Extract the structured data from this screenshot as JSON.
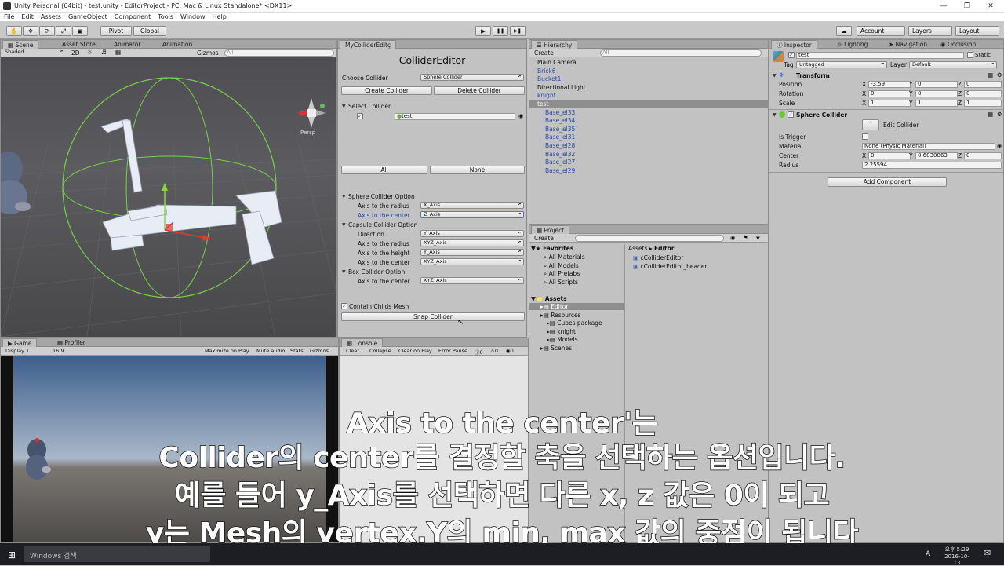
{
  "window": {
    "title": "Unity Personal (64bit) - test.unity - EditorProject - PC, Mac & Linux Standalone* <DX11>",
    "controls": [
      "—",
      "❐",
      "✕"
    ]
  },
  "menu": [
    "File",
    "Edit",
    "Assets",
    "GameObject",
    "Component",
    "Tools",
    "Window",
    "Help"
  ],
  "toolbar": {
    "pivot": "Pivot",
    "global": "Global",
    "play": "▶",
    "pause": "❚❚",
    "step": "▶❚",
    "account": "Account",
    "layers": "Layers",
    "layout": "Layout"
  },
  "scene": {
    "tabs": [
      "Scene",
      "Asset Store",
      "Animator",
      "Animation"
    ],
    "shading": "Shaded",
    "mode_2d": "2D",
    "gizmos": "Gizmos",
    "search_placeholder": "All",
    "persp": "Persp"
  },
  "collider_editor": {
    "tab": "MyColliderEditç",
    "title": "ColliderEditor",
    "choose_label": "Choose Collider",
    "choose_value": "Sphere Collider",
    "create_button": "Create Collider",
    "delete_button": "Delete Collider",
    "select_header": "Select Collider",
    "selected_item": "test",
    "all_button": "All",
    "none_button": "None",
    "sphere_header": "Sphere Collider Option",
    "sphere_radius_label": "Axis to the radius",
    "sphere_radius_value": "X_Axis",
    "sphere_center_label": "Axis to the center",
    "sphere_center_value": "Z_Axis",
    "capsule_header": "Capsule Collider Option",
    "capsule_direction_label": "Direction",
    "capsule_direction_value": "Y_Axis",
    "capsule_radius_label": "Axis to the radius",
    "capsule_radius_value": "XYZ_Axis",
    "capsule_height_label": "Axis to the height",
    "capsule_height_value": "Y_Axis",
    "capsule_center_label": "Axis to the center",
    "capsule_center_value": "XYZ_Axis",
    "box_header": "Box Collider Option",
    "box_center_label": "Axis to the center",
    "box_center_value": "XYZ_Axis",
    "contain_label": "Contain Childs Mesh",
    "snap_button": "Snap Collider"
  },
  "hierarchy": {
    "tab": "Hierarchy",
    "create": "Create",
    "search_placeholder": "All",
    "items": [
      {
        "label": "Main Camera",
        "indent": 0,
        "style": "normal"
      },
      {
        "label": "Brick6",
        "indent": 0,
        "style": "blue"
      },
      {
        "label": "Bucket1",
        "indent": 0,
        "style": "blue"
      },
      {
        "label": "Directional Light",
        "indent": 0,
        "style": "normal"
      },
      {
        "label": "knight",
        "indent": 0,
        "style": "blue"
      },
      {
        "label": "test",
        "indent": 0,
        "style": "selected"
      },
      {
        "label": "Base_el33",
        "indent": 1,
        "style": "blue"
      },
      {
        "label": "Base_el34",
        "indent": 1,
        "style": "blue"
      },
      {
        "label": "Base_el35",
        "indent": 1,
        "style": "blue"
      },
      {
        "label": "Base_el31",
        "indent": 1,
        "style": "blue"
      },
      {
        "label": "Base_el28",
        "indent": 1,
        "style": "blue"
      },
      {
        "label": "Base_el32",
        "indent": 1,
        "style": "blue"
      },
      {
        "label": "Base_el27",
        "indent": 1,
        "style": "blue"
      },
      {
        "label": "Base_el29",
        "indent": 1,
        "style": "blue"
      }
    ]
  },
  "project": {
    "tab": "Project",
    "create": "Create",
    "favorites_header": "Favorites",
    "favorites": [
      "All Materials",
      "All Models",
      "All Prefabs",
      "All Scripts"
    ],
    "assets_header": "Assets",
    "tree": [
      {
        "label": "Editor",
        "indent": 1,
        "selected": true
      },
      {
        "label": "Resources",
        "indent": 1,
        "selected": false
      },
      {
        "label": "Cubes package",
        "indent": 2,
        "selected": false
      },
      {
        "label": "knight",
        "indent": 2,
        "selected": false
      },
      {
        "label": "Models",
        "indent": 2,
        "selected": false
      },
      {
        "label": "Scenes",
        "indent": 1,
        "selected": false
      }
    ],
    "breadcrumb_root": "Assets",
    "breadcrumb_sep": "▸",
    "breadcrumb_current": "Editor",
    "files": [
      "cColliderEditor",
      "cColliderEditor_header"
    ]
  },
  "inspector": {
    "tabs": [
      "Inspector",
      "Lighting",
      "Navigation",
      "Occlusion"
    ],
    "object_name": "test",
    "static_label": "Static",
    "tag_label": "Tag",
    "tag_value": "Untagged",
    "layer_label": "Layer",
    "layer_value": "Default",
    "transform_header": "Transform",
    "position_label": "Position",
    "position": {
      "x": "-3.59",
      "y": "0",
      "z": "0"
    },
    "rotation_label": "Rotation",
    "rotation": {
      "x": "0",
      "y": "0",
      "z": "0"
    },
    "scale_label": "Scale",
    "scale": {
      "x": "1",
      "y": "1",
      "z": "1"
    },
    "sphere_header": "Sphere Collider",
    "edit_collider": "Edit Collider",
    "is_trigger_label": "Is Trigger",
    "material_label": "Material",
    "material_value": "None (Physic Material)",
    "center_label": "Center",
    "center": {
      "x": "0",
      "y": "0.6830863",
      "z": "0"
    },
    "radius_label": "Radius",
    "radius_value": "2.25594",
    "add_component": "Add Component"
  },
  "game": {
    "tabs": [
      "Game",
      "Profiler"
    ],
    "display": "Display 1",
    "aspect": "16:9",
    "buttons": [
      "Maximize on Play",
      "Mute audio",
      "Stats",
      "Gizmos"
    ]
  },
  "console": {
    "tab": "Console",
    "buttons": [
      "Clear",
      "Collapse",
      "Clear on Play",
      "Error Pause"
    ],
    "counts": [
      "0",
      "0",
      "0"
    ]
  },
  "subtitles": [
    "Axis to the center'는",
    "Collider의 center를 결정할 축을 선택하는 옵션입니다.",
    "예를 들어 y_Axis를 선택하면 다른 x, z 값은 0이 되고",
    "y는 Mesh의 vertex.Y의 min, max 값의 중점이 됩니다"
  ],
  "taskbar": {
    "search": "Windows 검색",
    "time": "오후 5:29",
    "date": "2016-10-13",
    "ime": "A"
  }
}
